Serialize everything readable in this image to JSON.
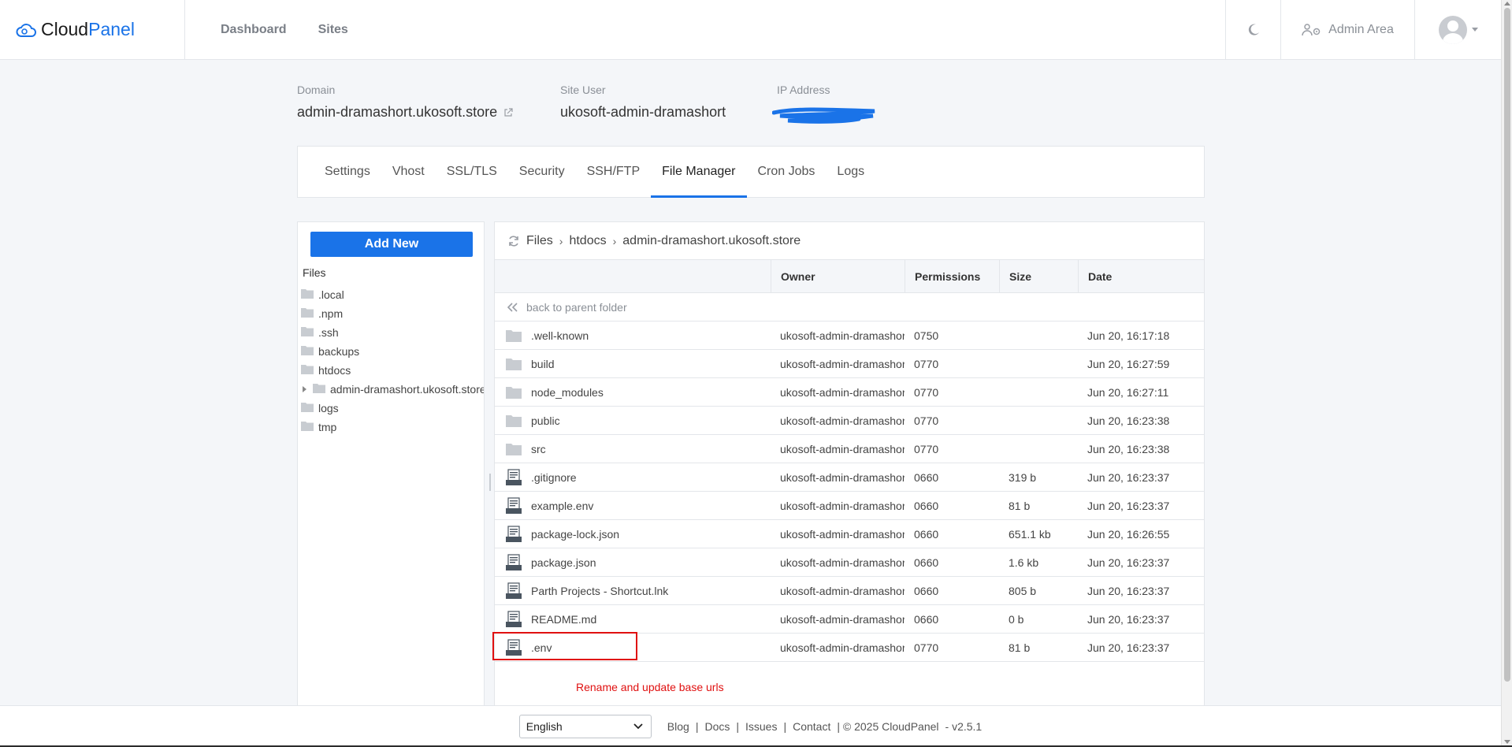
{
  "header": {
    "brand_part1": "Cloud",
    "brand_part2": "Panel",
    "nav": [
      {
        "label": "Dashboard"
      },
      {
        "label": "Sites"
      }
    ],
    "admin_area": "Admin Area"
  },
  "site_info": {
    "domain_label": "Domain",
    "domain_value": "admin-dramashort.ukosoft.store",
    "site_user_label": "Site User",
    "site_user_value": "ukosoft-admin-dramashort",
    "ip_label": "IP Address"
  },
  "tabs": [
    {
      "label": "Settings"
    },
    {
      "label": "Vhost"
    },
    {
      "label": "SSL/TLS"
    },
    {
      "label": "Security"
    },
    {
      "label": "SSH/FTP"
    },
    {
      "label": "File Manager",
      "active": true
    },
    {
      "label": "Cron Jobs"
    },
    {
      "label": "Logs"
    }
  ],
  "tree": {
    "add_new": "Add New",
    "root": "Files",
    "items": [
      {
        "label": ".local"
      },
      {
        "label": ".npm"
      },
      {
        "label": ".ssh"
      },
      {
        "label": "backups"
      },
      {
        "label": "htdocs"
      },
      {
        "label": "admin-dramashort.ukosoft.store"
      },
      {
        "label": "logs"
      },
      {
        "label": "tmp"
      }
    ]
  },
  "breadcrumb": [
    "Files",
    "htdocs",
    "admin-dramashort.ukosoft.store"
  ],
  "table": {
    "headers": {
      "name": "",
      "owner": "Owner",
      "permissions": "Permissions",
      "size": "Size",
      "date": "Date"
    },
    "back": "back to parent folder",
    "rows": [
      {
        "type": "folder",
        "name": ".well-known",
        "owner": "ukosoft-admin-dramashort",
        "perm": "0750",
        "size": "",
        "date": "Jun 20, 16:17:18"
      },
      {
        "type": "folder",
        "name": "build",
        "owner": "ukosoft-admin-dramashort",
        "perm": "0770",
        "size": "",
        "date": "Jun 20, 16:27:59"
      },
      {
        "type": "folder",
        "name": "node_modules",
        "owner": "ukosoft-admin-dramashort",
        "perm": "0770",
        "size": "",
        "date": "Jun 20, 16:27:11"
      },
      {
        "type": "folder",
        "name": "public",
        "owner": "ukosoft-admin-dramashort",
        "perm": "0770",
        "size": "",
        "date": "Jun 20, 16:23:38"
      },
      {
        "type": "folder",
        "name": "src",
        "owner": "ukosoft-admin-dramashort",
        "perm": "0770",
        "size": "",
        "date": "Jun 20, 16:23:38"
      },
      {
        "type": "file",
        "name": ".gitignore",
        "owner": "ukosoft-admin-dramashort",
        "perm": "0660",
        "size": "319 b",
        "date": "Jun 20, 16:23:37"
      },
      {
        "type": "file",
        "name": "example.env",
        "owner": "ukosoft-admin-dramashort",
        "perm": "0660",
        "size": "81 b",
        "date": "Jun 20, 16:23:37"
      },
      {
        "type": "file",
        "name": "package-lock.json",
        "owner": "ukosoft-admin-dramashort",
        "perm": "0660",
        "size": "651.1 kb",
        "date": "Jun 20, 16:26:55"
      },
      {
        "type": "file",
        "name": "package.json",
        "owner": "ukosoft-admin-dramashort",
        "perm": "0660",
        "size": "1.6 kb",
        "date": "Jun 20, 16:23:37"
      },
      {
        "type": "file",
        "name": "Parth Projects - Shortcut.lnk",
        "owner": "ukosoft-admin-dramashort",
        "perm": "0660",
        "size": "805 b",
        "date": "Jun 20, 16:23:37"
      },
      {
        "type": "file",
        "name": "README.md",
        "owner": "ukosoft-admin-dramashort",
        "perm": "0660",
        "size": "0 b",
        "date": "Jun 20, 16:23:37"
      },
      {
        "type": "file",
        "name": ".env",
        "owner": "ukosoft-admin-dramashort",
        "perm": "0770",
        "size": "81 b",
        "date": "Jun 20, 16:23:37"
      }
    ]
  },
  "annotation": "Rename and update base urls",
  "footer": {
    "language": "English",
    "links": [
      "Blog",
      "Docs",
      "Issues",
      "Contact"
    ],
    "copyright": "| © 2025  CloudPanel",
    "version": "- v2.5.1"
  },
  "colors": {
    "accent": "#1a73e8",
    "annotation": "#e01010"
  }
}
